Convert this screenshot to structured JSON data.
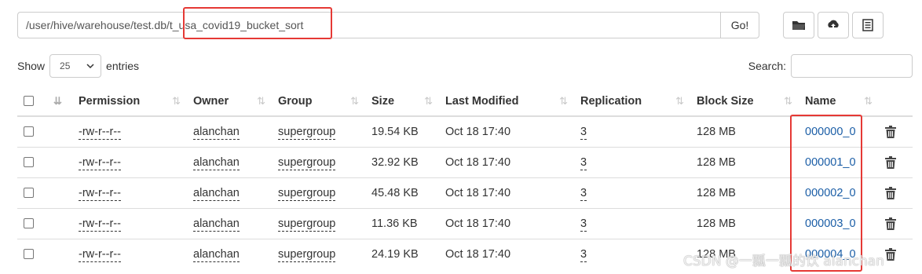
{
  "path": {
    "value": "/user/hive/warehouse/test.db/t_usa_covid19_bucket_sort",
    "go_label": "Go!"
  },
  "toolbar": {
    "icons": [
      "folder-icon",
      "upload-icon",
      "list-icon"
    ]
  },
  "entries": {
    "show_label": "Show",
    "page_size": "25",
    "entries_label": "entries",
    "search_label": "Search:"
  },
  "table": {
    "columns": [
      "Permission",
      "Owner",
      "Group",
      "Size",
      "Last Modified",
      "Replication",
      "Block Size",
      "Name"
    ],
    "rows": [
      {
        "permission": "-rw-r--r--",
        "owner": "alanchan",
        "group": "supergroup",
        "size": "19.54 KB",
        "modified": "Oct 18 17:40",
        "replication": "3",
        "block_size": "128 MB",
        "name": "000000_0"
      },
      {
        "permission": "-rw-r--r--",
        "owner": "alanchan",
        "group": "supergroup",
        "size": "32.92 KB",
        "modified": "Oct 18 17:40",
        "replication": "3",
        "block_size": "128 MB",
        "name": "000001_0"
      },
      {
        "permission": "-rw-r--r--",
        "owner": "alanchan",
        "group": "supergroup",
        "size": "45.48 KB",
        "modified": "Oct 18 17:40",
        "replication": "3",
        "block_size": "128 MB",
        "name": "000002_0"
      },
      {
        "permission": "-rw-r--r--",
        "owner": "alanchan",
        "group": "supergroup",
        "size": "11.36 KB",
        "modified": "Oct 18 17:40",
        "replication": "3",
        "block_size": "128 MB",
        "name": "000003_0"
      },
      {
        "permission": "-rw-r--r--",
        "owner": "alanchan",
        "group": "supergroup",
        "size": "24.19 KB",
        "modified": "Oct 18 17:40",
        "replication": "3",
        "block_size": "128 MB",
        "name": "000004_0"
      }
    ]
  },
  "watermark": "CSDN @一瓢一瓢的饮 alanchan",
  "colors": {
    "highlight": "#e53935",
    "link": "#1a5da6"
  }
}
